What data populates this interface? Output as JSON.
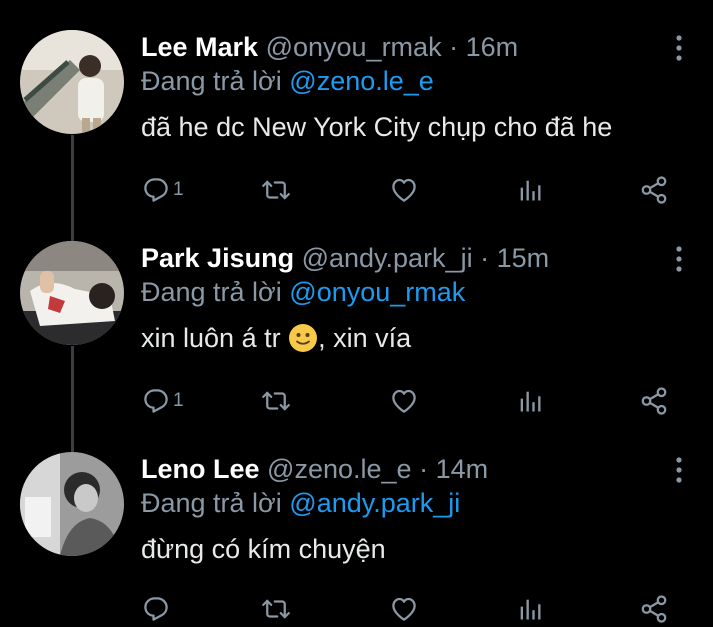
{
  "theme": {
    "background": "#000000",
    "text": "#e7e9ea",
    "muted": "#8b98a5",
    "mention": "#1d9bf0",
    "thread_line": "#3a3d41"
  },
  "tweets": [
    {
      "name": "Lee Mark",
      "handle": "@onyou_rmak",
      "separator": "·",
      "time": "16m",
      "reply_prefix": "Đang trả lời",
      "reply_to": "@zeno.le_e",
      "text": "đã he dc New York City chụp cho đã he",
      "reply_count": "1",
      "icons": [
        "reply-icon",
        "retweet-icon",
        "like-icon",
        "analytics-icon",
        "share-icon",
        "more-vertical-icon"
      ]
    },
    {
      "name": "Park Jisung",
      "handle": "@andy.park_ji",
      "separator": "·",
      "time": "15m",
      "reply_prefix": "Đang trả lời",
      "reply_to": "@onyou_rmak",
      "text_before_emoji": "xin luôn á tr ",
      "emoji": "slightly-smiling-face",
      "text_after_emoji": ", xin vía",
      "reply_count": "1"
    },
    {
      "name": "Leno Lee",
      "handle": "@zeno.le_e",
      "separator": "·",
      "time": "14m",
      "reply_prefix": "Đang trả lời",
      "reply_to": "@andy.park_ji",
      "text": "đừng có kím chuyện",
      "reply_count": ""
    }
  ]
}
